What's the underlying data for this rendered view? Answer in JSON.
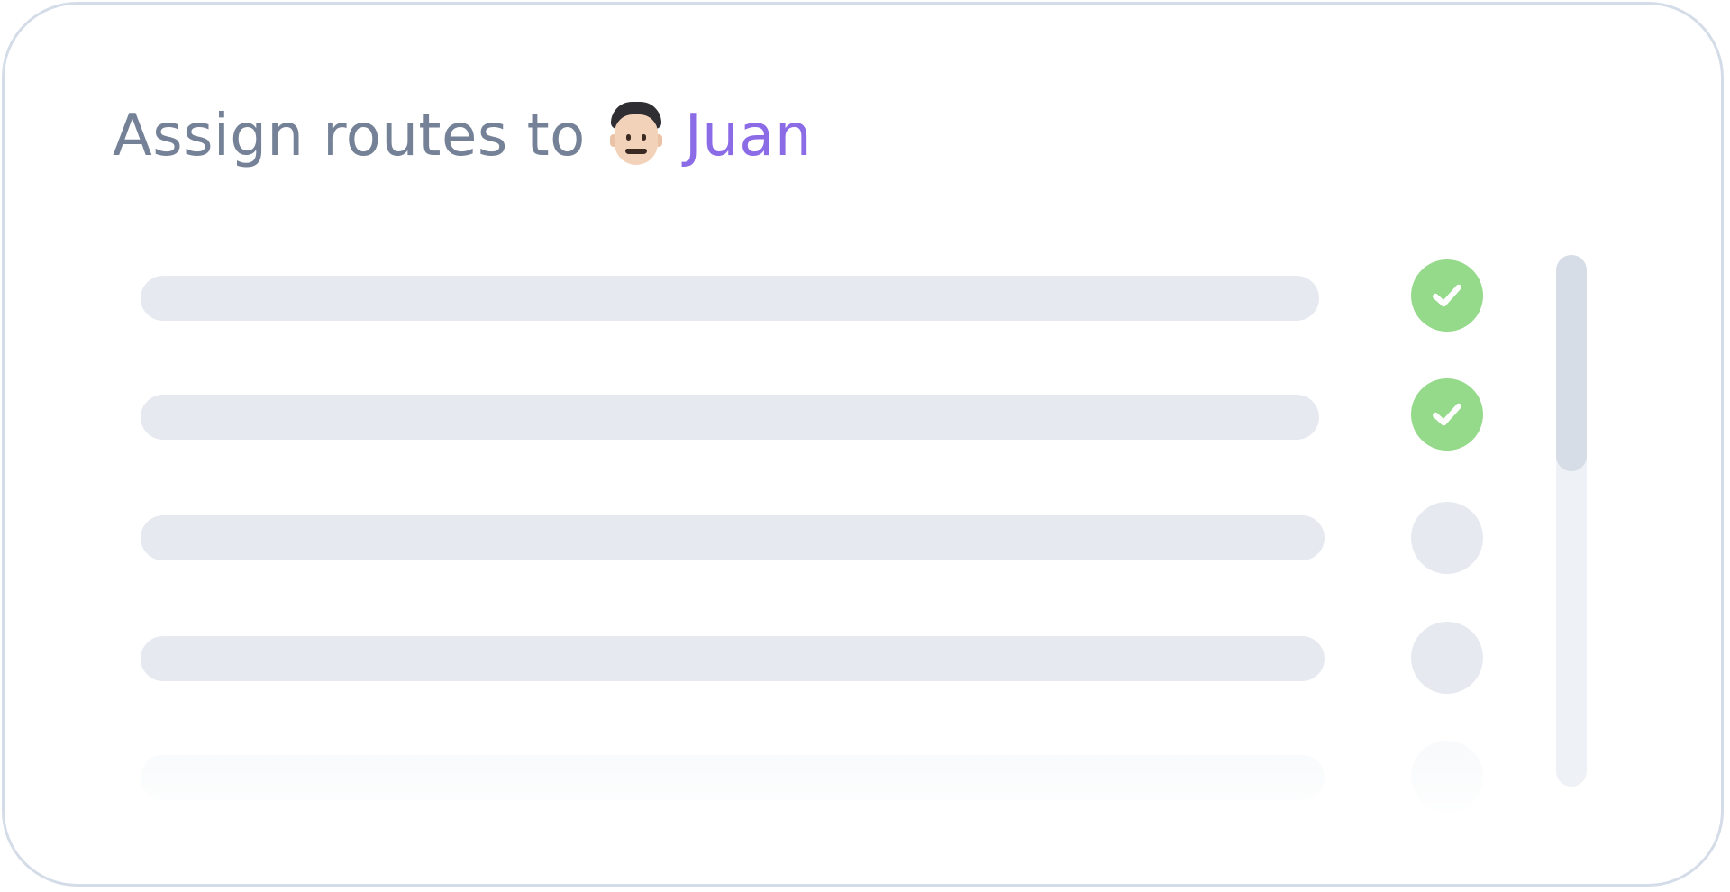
{
  "dialog": {
    "title_prefix": "Assign routes to",
    "assignee_name": "Juan",
    "assignee_avatar_icon": "man-with-mustache-avatar-icon"
  },
  "routes": [
    {
      "checked": true
    },
    {
      "checked": true
    },
    {
      "checked": false
    },
    {
      "checked": false
    },
    {
      "checked": false
    }
  ],
  "scroll": {
    "position": 0
  },
  "colors": {
    "title": "#748196",
    "name_accent": "#8b6be6",
    "checked": "#95d98a",
    "placeholder": "#e6eaf0",
    "border": "#d4dce8"
  }
}
